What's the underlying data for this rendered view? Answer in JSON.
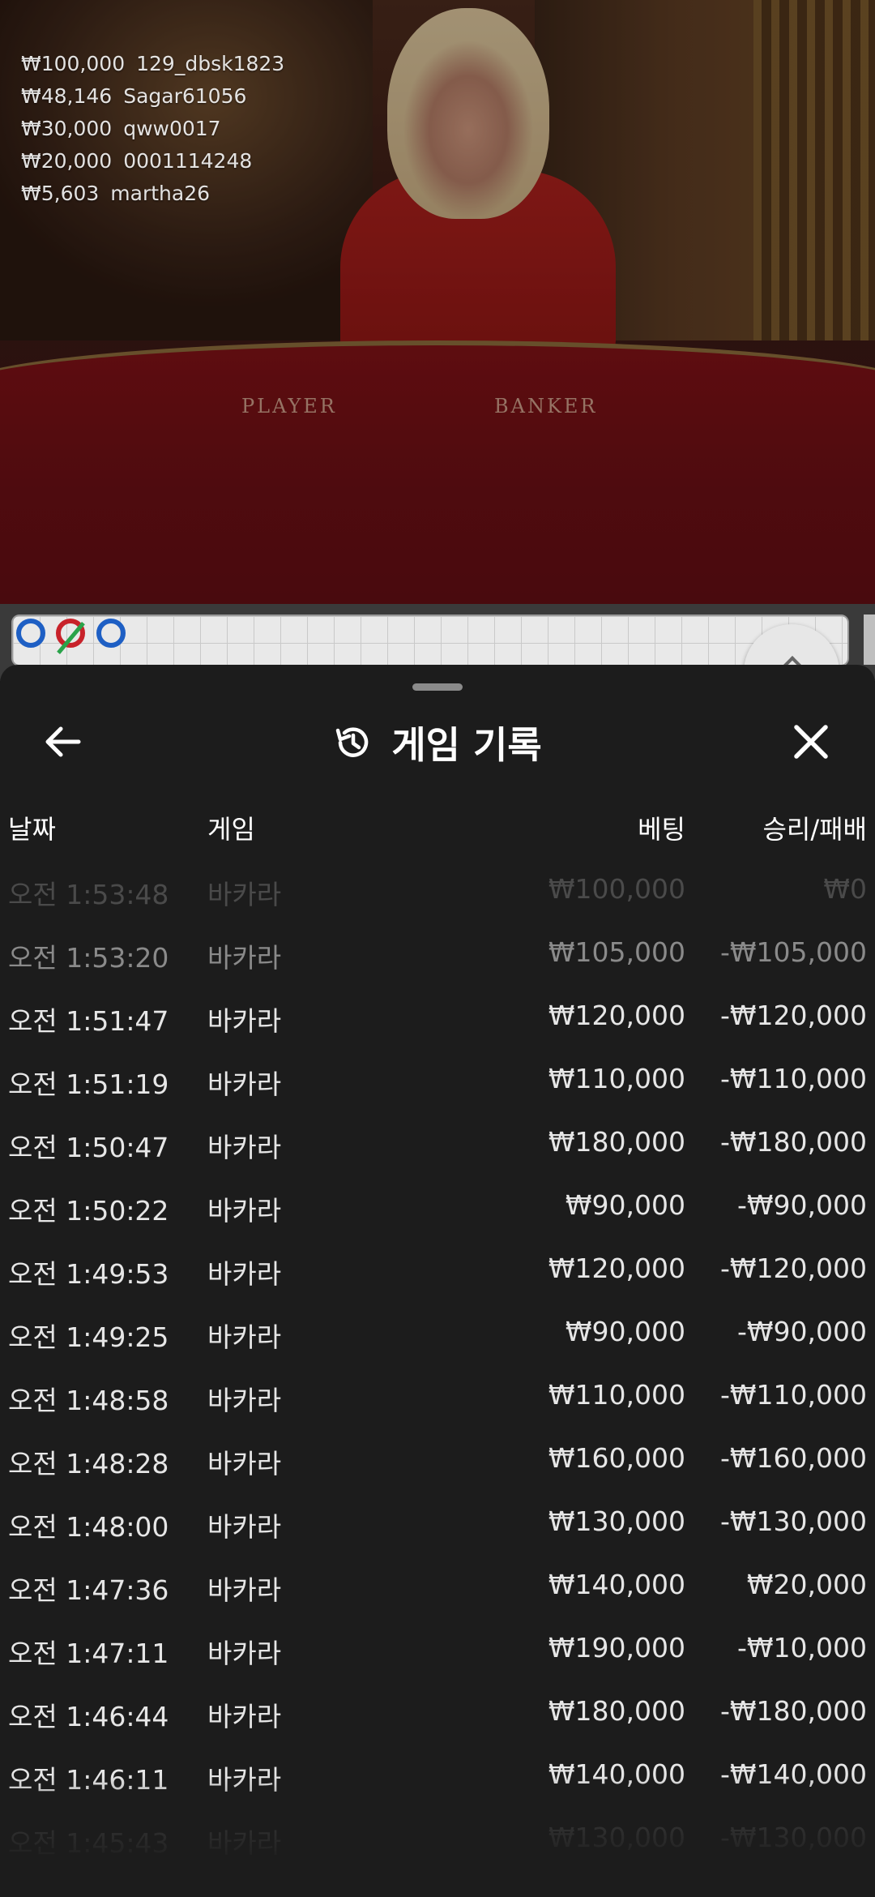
{
  "live_bets": [
    {
      "amount": "₩100,000",
      "user": "129_dbsk1823"
    },
    {
      "amount": "₩48,146",
      "user": "Sagar61056"
    },
    {
      "amount": "₩30,000",
      "user": "qww0017"
    },
    {
      "amount": "₩20,000",
      "user": "0001114248"
    },
    {
      "amount": "₩5,603",
      "user": "martha26"
    }
  ],
  "table": {
    "player_label": "PLAYER",
    "banker_label": "BANKER"
  },
  "road": {
    "results": [
      "player",
      "banker-tie",
      "player"
    ]
  },
  "sheet": {
    "title": "게임 기록",
    "columns": {
      "date": "날짜",
      "game": "게임",
      "bet": "베팅",
      "result": "승리/패배"
    },
    "rows": [
      {
        "date": "오전 1:53:48",
        "game": "바카라",
        "bet": "₩100,000",
        "result": "₩0"
      },
      {
        "date": "오전 1:53:20",
        "game": "바카라",
        "bet": "₩105,000",
        "result": "-₩105,000"
      },
      {
        "date": "오전 1:51:47",
        "game": "바카라",
        "bet": "₩120,000",
        "result": "-₩120,000"
      },
      {
        "date": "오전 1:51:19",
        "game": "바카라",
        "bet": "₩110,000",
        "result": "-₩110,000"
      },
      {
        "date": "오전 1:50:47",
        "game": "바카라",
        "bet": "₩180,000",
        "result": "-₩180,000"
      },
      {
        "date": "오전 1:50:22",
        "game": "바카라",
        "bet": "₩90,000",
        "result": "-₩90,000"
      },
      {
        "date": "오전 1:49:53",
        "game": "바카라",
        "bet": "₩120,000",
        "result": "-₩120,000"
      },
      {
        "date": "오전 1:49:25",
        "game": "바카라",
        "bet": "₩90,000",
        "result": "-₩90,000"
      },
      {
        "date": "오전 1:48:58",
        "game": "바카라",
        "bet": "₩110,000",
        "result": "-₩110,000"
      },
      {
        "date": "오전 1:48:28",
        "game": "바카라",
        "bet": "₩160,000",
        "result": "-₩160,000"
      },
      {
        "date": "오전 1:48:00",
        "game": "바카라",
        "bet": "₩130,000",
        "result": "-₩130,000"
      },
      {
        "date": "오전 1:47:36",
        "game": "바카라",
        "bet": "₩140,000",
        "result": "₩20,000"
      },
      {
        "date": "오전 1:47:11",
        "game": "바카라",
        "bet": "₩190,000",
        "result": "-₩10,000"
      },
      {
        "date": "오전 1:46:44",
        "game": "바카라",
        "bet": "₩180,000",
        "result": "-₩180,000"
      },
      {
        "date": "오전 1:46:11",
        "game": "바카라",
        "bet": "₩140,000",
        "result": "-₩140,000"
      },
      {
        "date": "오전 1:45:43",
        "game": "바카라",
        "bet": "₩130,000",
        "result": "-₩130,000"
      }
    ]
  },
  "colors": {
    "sheet_bg": "#1c1c1c",
    "text": "#e6e6e6",
    "player_blue": "#1e5fc4",
    "banker_red": "#c8222a",
    "tie_green": "#2aa34a"
  },
  "icons": {
    "back": "arrow-left-icon",
    "history": "history-icon",
    "close": "close-icon",
    "expand": "chevron-up-icon"
  }
}
